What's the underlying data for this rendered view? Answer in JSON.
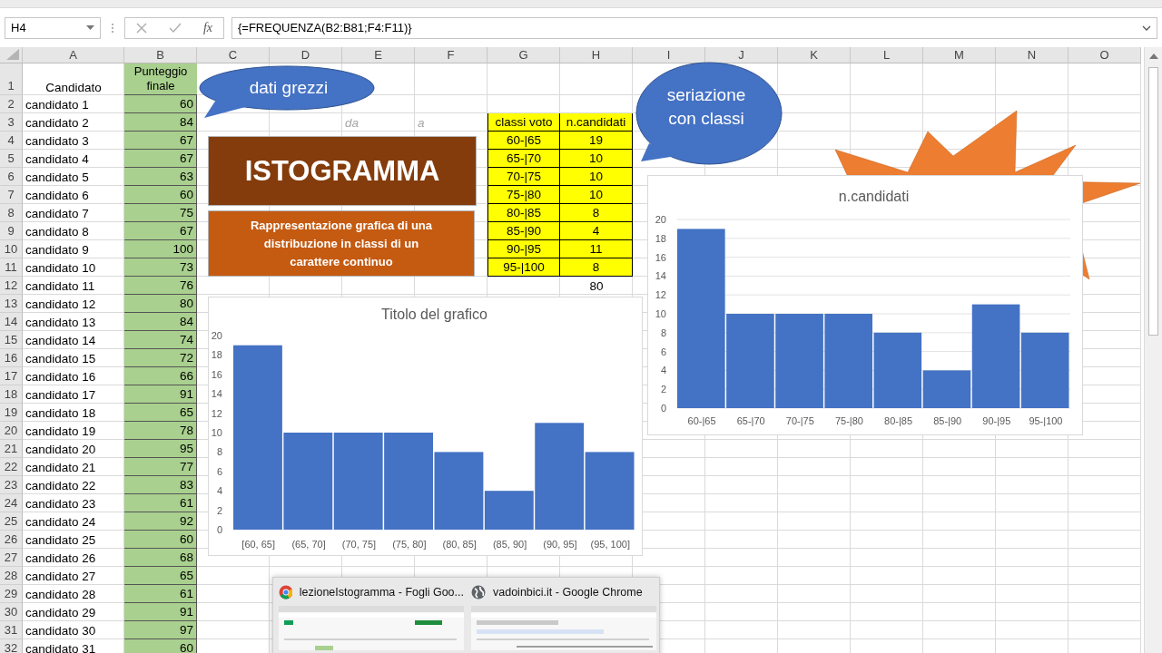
{
  "formula_bar": {
    "name_box": "H4",
    "function_label": "fx",
    "formula": "{=FREQUENZA(B2:B81;F4:F11)}"
  },
  "sheet": {
    "columns": [
      "A",
      "B",
      "C",
      "D",
      "E",
      "F",
      "G",
      "H",
      "I",
      "J",
      "K",
      "L",
      "M",
      "N",
      "O"
    ],
    "rows": [
      {
        "number": "1",
        "cells": {
          "A": {
            "text": "Candidato",
            "kind": "header"
          },
          "B": {
            "text": "Punteggio finale",
            "kind": "score_header"
          }
        }
      },
      {
        "number": "2",
        "cells": {
          "A": {
            "text": "candidato 1",
            "kind": "label"
          },
          "B": {
            "text": "60",
            "kind": "score"
          }
        }
      },
      {
        "number": "3",
        "cells": {
          "A": {
            "text": "candidato 2",
            "kind": "label"
          },
          "B": {
            "text": "84",
            "kind": "score"
          },
          "E": {
            "text": "da",
            "kind": "hint"
          },
          "F": {
            "text": "a",
            "kind": "hint"
          },
          "G": {
            "text": "classi voto",
            "kind": "class"
          },
          "H": {
            "text": "n.candidati",
            "kind": "class"
          }
        }
      },
      {
        "number": "4",
        "cells": {
          "A": {
            "text": "candidato 3",
            "kind": "label"
          },
          "B": {
            "text": "67",
            "kind": "score"
          },
          "G": {
            "text": "60-|65",
            "kind": "class"
          },
          "H": {
            "text": "19",
            "kind": "class"
          }
        }
      },
      {
        "number": "5",
        "cells": {
          "A": {
            "text": "candidato 4",
            "kind": "label"
          },
          "B": {
            "text": "67",
            "kind": "score"
          },
          "G": {
            "text": "65-|70",
            "kind": "class"
          },
          "H": {
            "text": "10",
            "kind": "class"
          }
        }
      },
      {
        "number": "6",
        "cells": {
          "A": {
            "text": "candidato 5",
            "kind": "label"
          },
          "B": {
            "text": "63",
            "kind": "score"
          },
          "G": {
            "text": "70-|75",
            "kind": "class"
          },
          "H": {
            "text": "10",
            "kind": "class"
          }
        }
      },
      {
        "number": "7",
        "cells": {
          "A": {
            "text": "candidato 6",
            "kind": "label"
          },
          "B": {
            "text": "60",
            "kind": "score"
          },
          "G": {
            "text": "75-|80",
            "kind": "class"
          },
          "H": {
            "text": "10",
            "kind": "class"
          }
        }
      },
      {
        "number": "8",
        "cells": {
          "A": {
            "text": "candidato 7",
            "kind": "label"
          },
          "B": {
            "text": "75",
            "kind": "score"
          },
          "G": {
            "text": "80-|85",
            "kind": "class"
          },
          "H": {
            "text": "8",
            "kind": "class"
          }
        }
      },
      {
        "number": "9",
        "cells": {
          "A": {
            "text": "candidato 8",
            "kind": "label"
          },
          "B": {
            "text": "67",
            "kind": "score"
          },
          "G": {
            "text": "85-|90",
            "kind": "class"
          },
          "H": {
            "text": "4",
            "kind": "class"
          }
        }
      },
      {
        "number": "10",
        "cells": {
          "A": {
            "text": "candidato 9",
            "kind": "label"
          },
          "B": {
            "text": "100",
            "kind": "score"
          },
          "G": {
            "text": "90-|95",
            "kind": "class"
          },
          "H": {
            "text": "11",
            "kind": "class"
          }
        }
      },
      {
        "number": "11",
        "cells": {
          "A": {
            "text": "candidato 10",
            "kind": "label"
          },
          "B": {
            "text": "73",
            "kind": "score"
          },
          "G": {
            "text": "95-|100",
            "kind": "class"
          },
          "H": {
            "text": "8",
            "kind": "class"
          }
        }
      },
      {
        "number": "12",
        "cells": {
          "A": {
            "text": "candidato 11",
            "kind": "label"
          },
          "B": {
            "text": "76",
            "kind": "score"
          },
          "H": {
            "text": "80",
            "kind": "total"
          }
        }
      },
      {
        "number": "13",
        "cells": {
          "A": {
            "text": "candidato 12",
            "kind": "label"
          },
          "B": {
            "text": "80",
            "kind": "score"
          }
        }
      },
      {
        "number": "14",
        "cells": {
          "A": {
            "text": "candidato 13",
            "kind": "label"
          },
          "B": {
            "text": "84",
            "kind": "score"
          }
        }
      },
      {
        "number": "15",
        "cells": {
          "A": {
            "text": "candidato 14",
            "kind": "label"
          },
          "B": {
            "text": "74",
            "kind": "score"
          }
        }
      },
      {
        "number": "16",
        "cells": {
          "A": {
            "text": "candidato 15",
            "kind": "label"
          },
          "B": {
            "text": "72",
            "kind": "score"
          }
        }
      },
      {
        "number": "17",
        "cells": {
          "A": {
            "text": "candidato 16",
            "kind": "label"
          },
          "B": {
            "text": "66",
            "kind": "score"
          }
        }
      },
      {
        "number": "18",
        "cells": {
          "A": {
            "text": "candidato 17",
            "kind": "label"
          },
          "B": {
            "text": "91",
            "kind": "score"
          }
        }
      },
      {
        "number": "19",
        "cells": {
          "A": {
            "text": "candidato 18",
            "kind": "label"
          },
          "B": {
            "text": "65",
            "kind": "score"
          }
        }
      },
      {
        "number": "20",
        "cells": {
          "A": {
            "text": "candidato 19",
            "kind": "label"
          },
          "B": {
            "text": "78",
            "kind": "score"
          }
        }
      },
      {
        "number": "21",
        "cells": {
          "A": {
            "text": "candidato 20",
            "kind": "label"
          },
          "B": {
            "text": "95",
            "kind": "score"
          }
        }
      },
      {
        "number": "22",
        "cells": {
          "A": {
            "text": "candidato 21",
            "kind": "label"
          },
          "B": {
            "text": "77",
            "kind": "score"
          }
        }
      },
      {
        "number": "23",
        "cells": {
          "A": {
            "text": "candidato 22",
            "kind": "label"
          },
          "B": {
            "text": "83",
            "kind": "score"
          }
        }
      },
      {
        "number": "24",
        "cells": {
          "A": {
            "text": "candidato 23",
            "kind": "label"
          },
          "B": {
            "text": "61",
            "kind": "score"
          }
        }
      },
      {
        "number": "25",
        "cells": {
          "A": {
            "text": "candidato 24",
            "kind": "label"
          },
          "B": {
            "text": "92",
            "kind": "score"
          }
        }
      },
      {
        "number": "26",
        "cells": {
          "A": {
            "text": "candidato 25",
            "kind": "label"
          },
          "B": {
            "text": "60",
            "kind": "score"
          }
        }
      },
      {
        "number": "27",
        "cells": {
          "A": {
            "text": "candidato 26",
            "kind": "label"
          },
          "B": {
            "text": "68",
            "kind": "score"
          }
        }
      },
      {
        "number": "28",
        "cells": {
          "A": {
            "text": "candidato 27",
            "kind": "label"
          },
          "B": {
            "text": "65",
            "kind": "score"
          }
        }
      },
      {
        "number": "29",
        "cells": {
          "A": {
            "text": "candidato 28",
            "kind": "label"
          },
          "B": {
            "text": "61",
            "kind": "score"
          }
        }
      },
      {
        "number": "30",
        "cells": {
          "A": {
            "text": "candidato 29",
            "kind": "label"
          },
          "B": {
            "text": "91",
            "kind": "score"
          }
        }
      },
      {
        "number": "31",
        "cells": {
          "A": {
            "text": "candidato 30",
            "kind": "label"
          },
          "B": {
            "text": "97",
            "kind": "score"
          }
        }
      },
      {
        "number": "32",
        "cells": {
          "A": {
            "text": "candidato 31",
            "kind": "label"
          },
          "B": {
            "text": "60",
            "kind": "score"
          }
        }
      }
    ]
  },
  "shapes": [
    {
      "kind": "callout",
      "text": "dati grezzi"
    },
    {
      "kind": "callout",
      "text": "seriazione con classi"
    },
    {
      "kind": "starburst"
    },
    {
      "kind": "title_box",
      "text": "ISTOGRAMMA"
    },
    {
      "kind": "subtitle_box",
      "text": "Rappresentazione grafica di una distribuzione in classi di un carattere continuo"
    }
  ],
  "charts": [
    {
      "chart_data": {
        "type": "bar",
        "title": "n.candidati",
        "grid": true,
        "categories": [
          "60-|65",
          "65-|70",
          "70-|75",
          "75-|80",
          "80-|85",
          "85-|90",
          "90-|95",
          "95-|100"
        ],
        "series": [
          {
            "color": "#4472c4",
            "values": [
              19,
              10,
              10,
              10,
              8,
              4,
              11,
              8
            ]
          }
        ],
        "ylim": [
          0,
          20
        ],
        "yticks": [
          {
            "value": 0,
            "label": "0"
          },
          {
            "value": 2,
            "label": "2"
          },
          {
            "value": 4,
            "label": "4"
          },
          {
            "value": 6,
            "label": "6"
          },
          {
            "value": 8,
            "label": "8"
          },
          {
            "value": 10,
            "label": "10"
          },
          {
            "value": 12,
            "label": "12"
          },
          {
            "value": 14,
            "label": "14"
          },
          {
            "value": 16,
            "label": "16"
          },
          {
            "value": 18,
            "label": "18"
          },
          {
            "value": 20,
            "label": "20"
          }
        ]
      }
    },
    {
      "chart_data": {
        "type": "bar",
        "title": "Titolo del grafico",
        "grid": false,
        "categories": [
          "[60, 65]",
          "(65, 70]",
          "(70, 75]",
          "(75, 80]",
          "(80, 85]",
          "(85, 90]",
          "(90, 95]",
          "(95, 100]"
        ],
        "series": [
          {
            "color": "#4472c4",
            "values": [
              19,
              10,
              10,
              10,
              8,
              4,
              11,
              8
            ]
          }
        ],
        "ylim": [
          0,
          20
        ],
        "yticks": [
          {
            "value": 0,
            "label": "0"
          },
          {
            "value": 2,
            "label": "2"
          },
          {
            "value": 4,
            "label": "4"
          },
          {
            "value": 6,
            "label": "6"
          },
          {
            "value": 8,
            "label": "8"
          },
          {
            "value": 10,
            "label": "10"
          },
          {
            "value": 12,
            "label": "12"
          },
          {
            "value": 14,
            "label": "14"
          },
          {
            "value": 16,
            "label": "16"
          },
          {
            "value": 18,
            "label": "18"
          },
          {
            "value": 20,
            "label": "20"
          }
        ]
      }
    }
  ],
  "taskbar_preview": {
    "windows": [
      {
        "kind": "chrome",
        "title": "lezioneIstogramma - Fogli Goo..."
      },
      {
        "kind": "globe",
        "title": "vadoinbici.it - Google Chrome"
      }
    ]
  }
}
